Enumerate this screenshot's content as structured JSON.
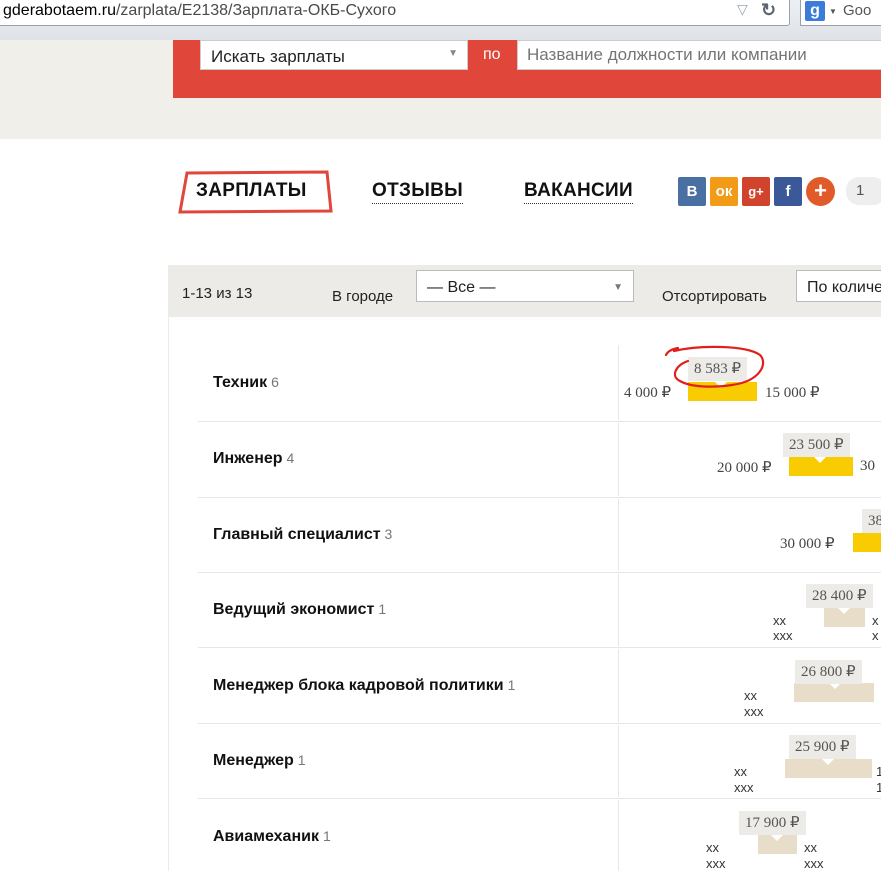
{
  "browser": {
    "url_host": "gderabotaem.ru",
    "url_path": "/zarplata/E2138/Зарплата-ОКБ-Сухого",
    "search_engine": "Goo"
  },
  "header": {
    "search_mode": "Искать зарплаты",
    "by_label": "по",
    "query_placeholder": "Название должности или компании"
  },
  "tabs": {
    "salaries": "ЗАРПЛАТЫ",
    "reviews": "ОТЗЫВЫ",
    "vacancies": "ВАКАНСИИ"
  },
  "social": {
    "vk": "В",
    "ok": "ок",
    "gplus": "g+",
    "fb": "f",
    "plus": "+",
    "count": "1"
  },
  "filters": {
    "result_count": "1-13 из 13",
    "city_label": "В городе",
    "city_value": "— Все —",
    "sort_label": "Отсортировать",
    "sort_value": "По количеству"
  },
  "colors": {
    "brand_red": "#e04639",
    "bar_yellow": "#f8cc00",
    "bar_beige": "#e8ddc9",
    "annotation_red": "#e0201c"
  },
  "rows": [
    {
      "title": "Техник",
      "count": "6",
      "avg": "8 583 ₽",
      "min": "4 000 ₽",
      "max": "15 000 ₽"
    },
    {
      "title": "Инженер",
      "count": "4",
      "avg": "23 500 ₽",
      "min": "20 000 ₽",
      "max": "30"
    },
    {
      "title": "Главный специалист",
      "count": "3",
      "avg": "38",
      "min": "30 000 ₽",
      "max": ""
    },
    {
      "title": "Ведущий экономист",
      "count": "1",
      "avg": "28 400 ₽",
      "min_line1": "xx",
      "min_line2": "xxx",
      "max_line1": "x",
      "max_line2": "x"
    },
    {
      "title": "Менеджер блока кадровой политики",
      "count": "1",
      "avg": "26 800 ₽",
      "min_line1": "xx",
      "min_line2": "xxx"
    },
    {
      "title": "Менеджер",
      "count": "1",
      "avg": "25 900 ₽",
      "min_line1": "xx",
      "min_line2": "xxx",
      "max_line1": "1",
      "max_line2": "1"
    },
    {
      "title": "Авиамеханик",
      "count": "1",
      "avg": "17 900 ₽",
      "min_line1": "xx",
      "min_line2": "xxx",
      "max_line1": "xx",
      "max_line2": "xxx"
    }
  ]
}
